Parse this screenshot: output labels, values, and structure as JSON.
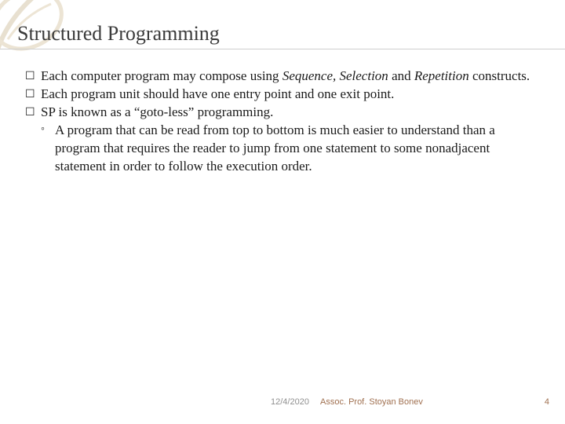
{
  "title": "Structured Programming",
  "bullets": {
    "b1_prefix": "Each computer program may compose using ",
    "b1_i1": "Sequence, Selection",
    "b1_mid": " and ",
    "b1_i2": "Repetition",
    "b1_suffix": " constructs.",
    "b2": "Each program unit should have one entry point and one exit point.",
    "b3": "SP is known as a “goto-less” programming.",
    "sub1": "A program that can be read from top to bottom is much easier to understand than a program that requires the reader to jump from one statement to some nonadjacent statement in order to follow the execution order."
  },
  "footer": {
    "date": "12/4/2020",
    "author": "Assoc. Prof. Stoyan Bonev",
    "page": "4"
  },
  "glyphs": {
    "checkbox": "☐",
    "circle": "◦"
  }
}
